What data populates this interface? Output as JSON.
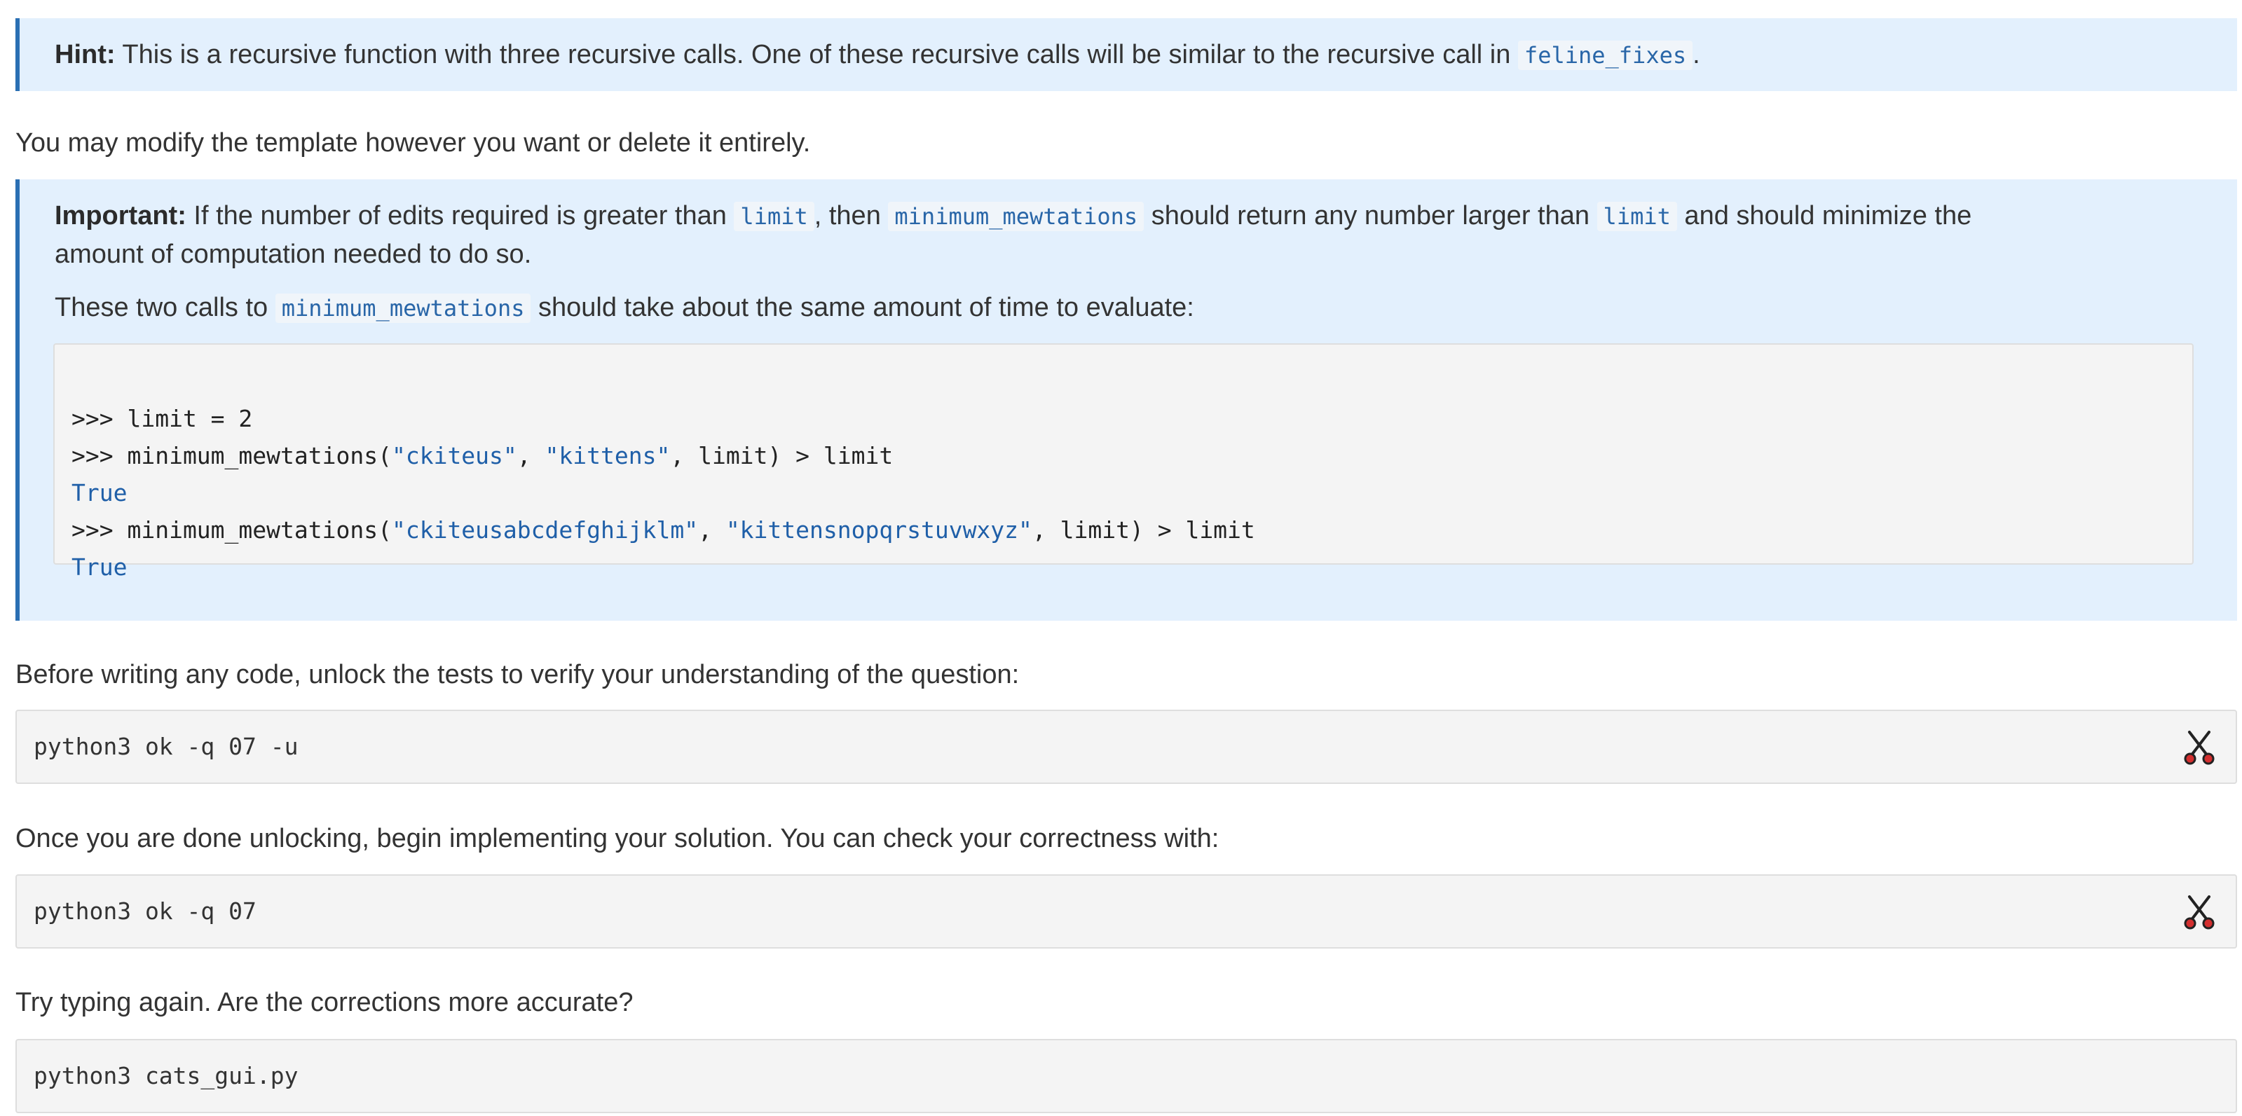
{
  "hint": {
    "label": "Hint:",
    "text": " This is a recursive function with three recursive calls. One of these recursive calls will be similar to the recursive call in ",
    "code": "feline_fixes",
    "end": "."
  },
  "modify_note": "You may modify the template however you want or delete it entirely.",
  "important": {
    "label": "Important:",
    "t1": " If the number of edits required is greater than ",
    "c1": "limit",
    "t2": ", then ",
    "c2": "minimum_mewtations",
    "t3": " should return any number larger than ",
    "c3": "limit",
    "t4": " and should minimize the",
    "line2": "amount of computation needed to do so.",
    "p2_a": "These two calls to ",
    "p2_code": "minimum_mewtations",
    "p2_b": " should take about the same amount of time to evaluate:",
    "repl": {
      "l1": ">>> limit = 2",
      "l2_a": ">>> minimum_mewtations(",
      "l2_s1": "\"ckiteus\"",
      "l2_b": ", ",
      "l2_s2": "\"kittens\"",
      "l2_c": ", limit) > limit",
      "l3": "True",
      "l4_a": ">>> minimum_mewtations(",
      "l4_s1": "\"ckiteusabcdefghijklm\"",
      "l4_b": ", ",
      "l4_s2": "\"kittensnopqrstuvwxyz\"",
      "l4_c": ", limit) > limit",
      "l5": "True"
    }
  },
  "unlock_note": "Before writing any code, unlock the tests to verify your understanding of the question:",
  "unlock_cmd": "python3 ok -q 07 -u",
  "check_note": "Once you are done unlocking, begin implementing your solution. You can check your correctness with:",
  "check_cmd": "python3 ok -q 07",
  "try_note": "Try typing again. Are the corrections more accurate?",
  "gui_cmd": "python3 cats_gui.py",
  "icons": {
    "copy": "scissors-icon"
  },
  "colors": {
    "callout_bg": "#e3f0fd",
    "callout_border": "#2a6fb3",
    "code_text": "#2966a8",
    "code_block_bg": "#f4f4f4"
  }
}
